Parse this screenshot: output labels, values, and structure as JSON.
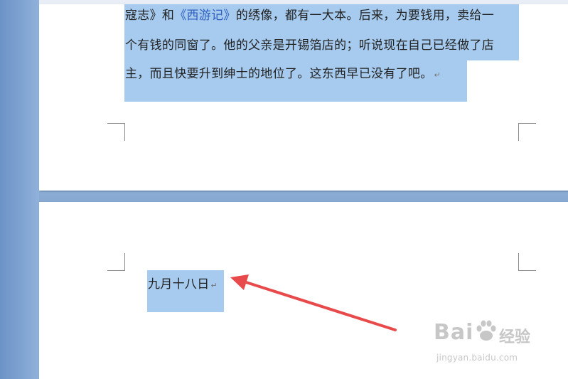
{
  "document": {
    "page1": {
      "lines": [
        {
          "before": "寇志》和",
          "link": "《西游记》",
          "after": "的绣像，都有一大本。后来，为要钱用，卖给一"
        },
        {
          "before": "个有钱的同窗了。他的父亲是开锡箔店的；听说现在自己已经做了店",
          "link": "",
          "after": ""
        },
        {
          "before": "主，而且快要升到绅士的地位了。这东西早已没有了吧。",
          "link": "",
          "after": ""
        }
      ],
      "paragraph_mark": "↵"
    },
    "page2": {
      "text": "九月十八日",
      "paragraph_mark": "↵"
    }
  },
  "annotation": {
    "arrow_color": "#e8494a"
  },
  "watermark": {
    "logo": "Bai",
    "brand": "经验",
    "url": "jingyan.baidu.com"
  },
  "colors": {
    "selection": "#a6cbef",
    "link": "#2f5fbf",
    "background": "#8fb0d6"
  }
}
